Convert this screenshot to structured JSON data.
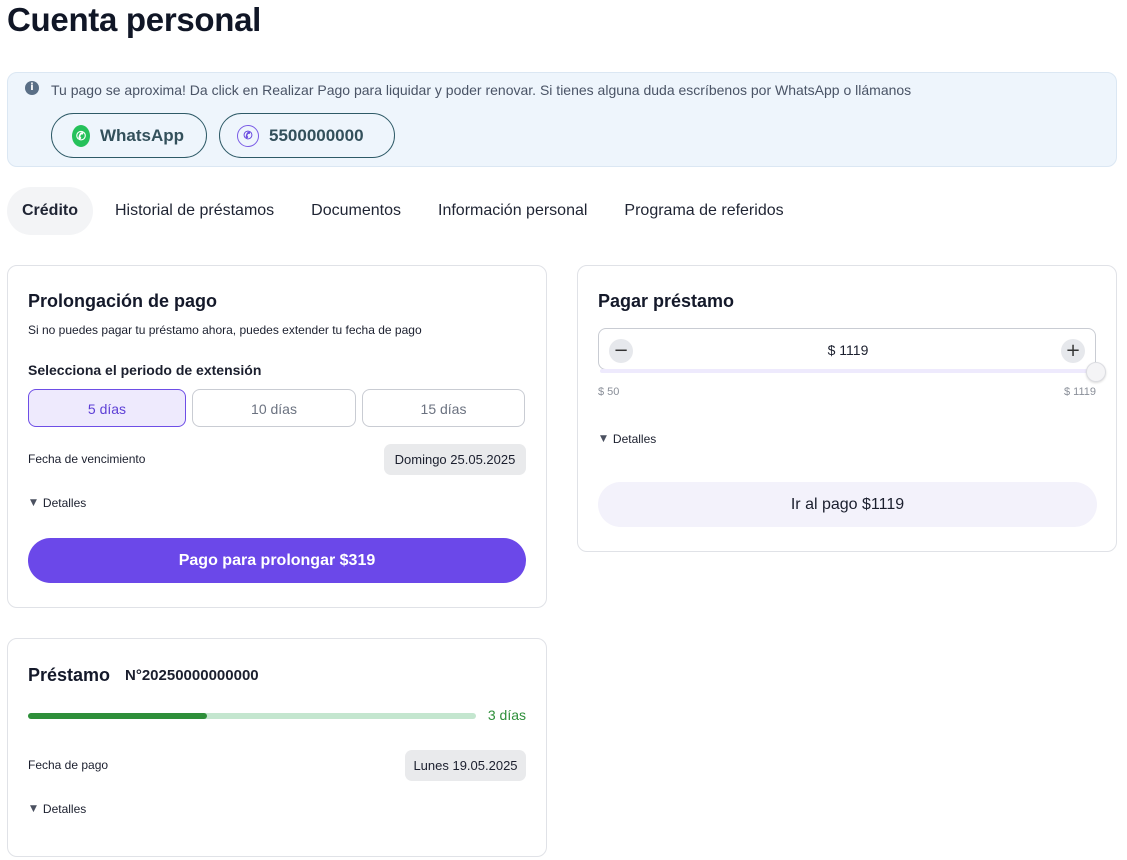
{
  "page": {
    "title": "Cuenta personal"
  },
  "alert": {
    "icon": "info-icon",
    "message": "Tu pago se aproxima! Da click en Realizar Pago para liquidar y poder renovar. Si tienes alguna duda escríbenos por WhatsApp o llámanos",
    "whatsapp_label": "WhatsApp",
    "phone_label": "5500000000"
  },
  "tabs": [
    {
      "label": "Crédito",
      "active": true
    },
    {
      "label": "Historial de préstamos"
    },
    {
      "label": "Documentos"
    },
    {
      "label": "Información personal"
    },
    {
      "label": "Programa de referidos"
    }
  ],
  "prolongacion": {
    "title": "Prolongación de pago",
    "subtitle": "Si no puedes pagar tu préstamo ahora, puedes extender tu fecha de pago",
    "period_label": "Selecciona el periodo de extensión",
    "options": [
      "5 días",
      "10 días",
      "15 días"
    ],
    "selected_option": "5 días",
    "due_label": "Fecha de vencimiento",
    "due_date": "Domingo 25.05.2025",
    "details_label": "Detalles",
    "button_label": "Pago para prolongar $319"
  },
  "pagar": {
    "title": "Pagar préstamo",
    "amount": "$ 1119",
    "min_label": "$ 50",
    "max_label": "$ 1119",
    "slider_value": 1119,
    "slider_min": 50,
    "slider_max": 1119,
    "details_label": "Detalles",
    "button_label": "Ir al pago $1119"
  },
  "prestamo": {
    "title": "Préstamo",
    "number": "N°20250000000000",
    "progress_fraction": 0.4,
    "days_left": "3 días",
    "payment_label": "Fecha de pago",
    "payment_date": "Lunes 19.05.2025",
    "details_label": "Detalles"
  },
  "colors": {
    "primary": "#6b48e9",
    "success": "#2e8f3a",
    "alert_bg": "#eef5fc",
    "whatsapp": "#25c15a"
  }
}
